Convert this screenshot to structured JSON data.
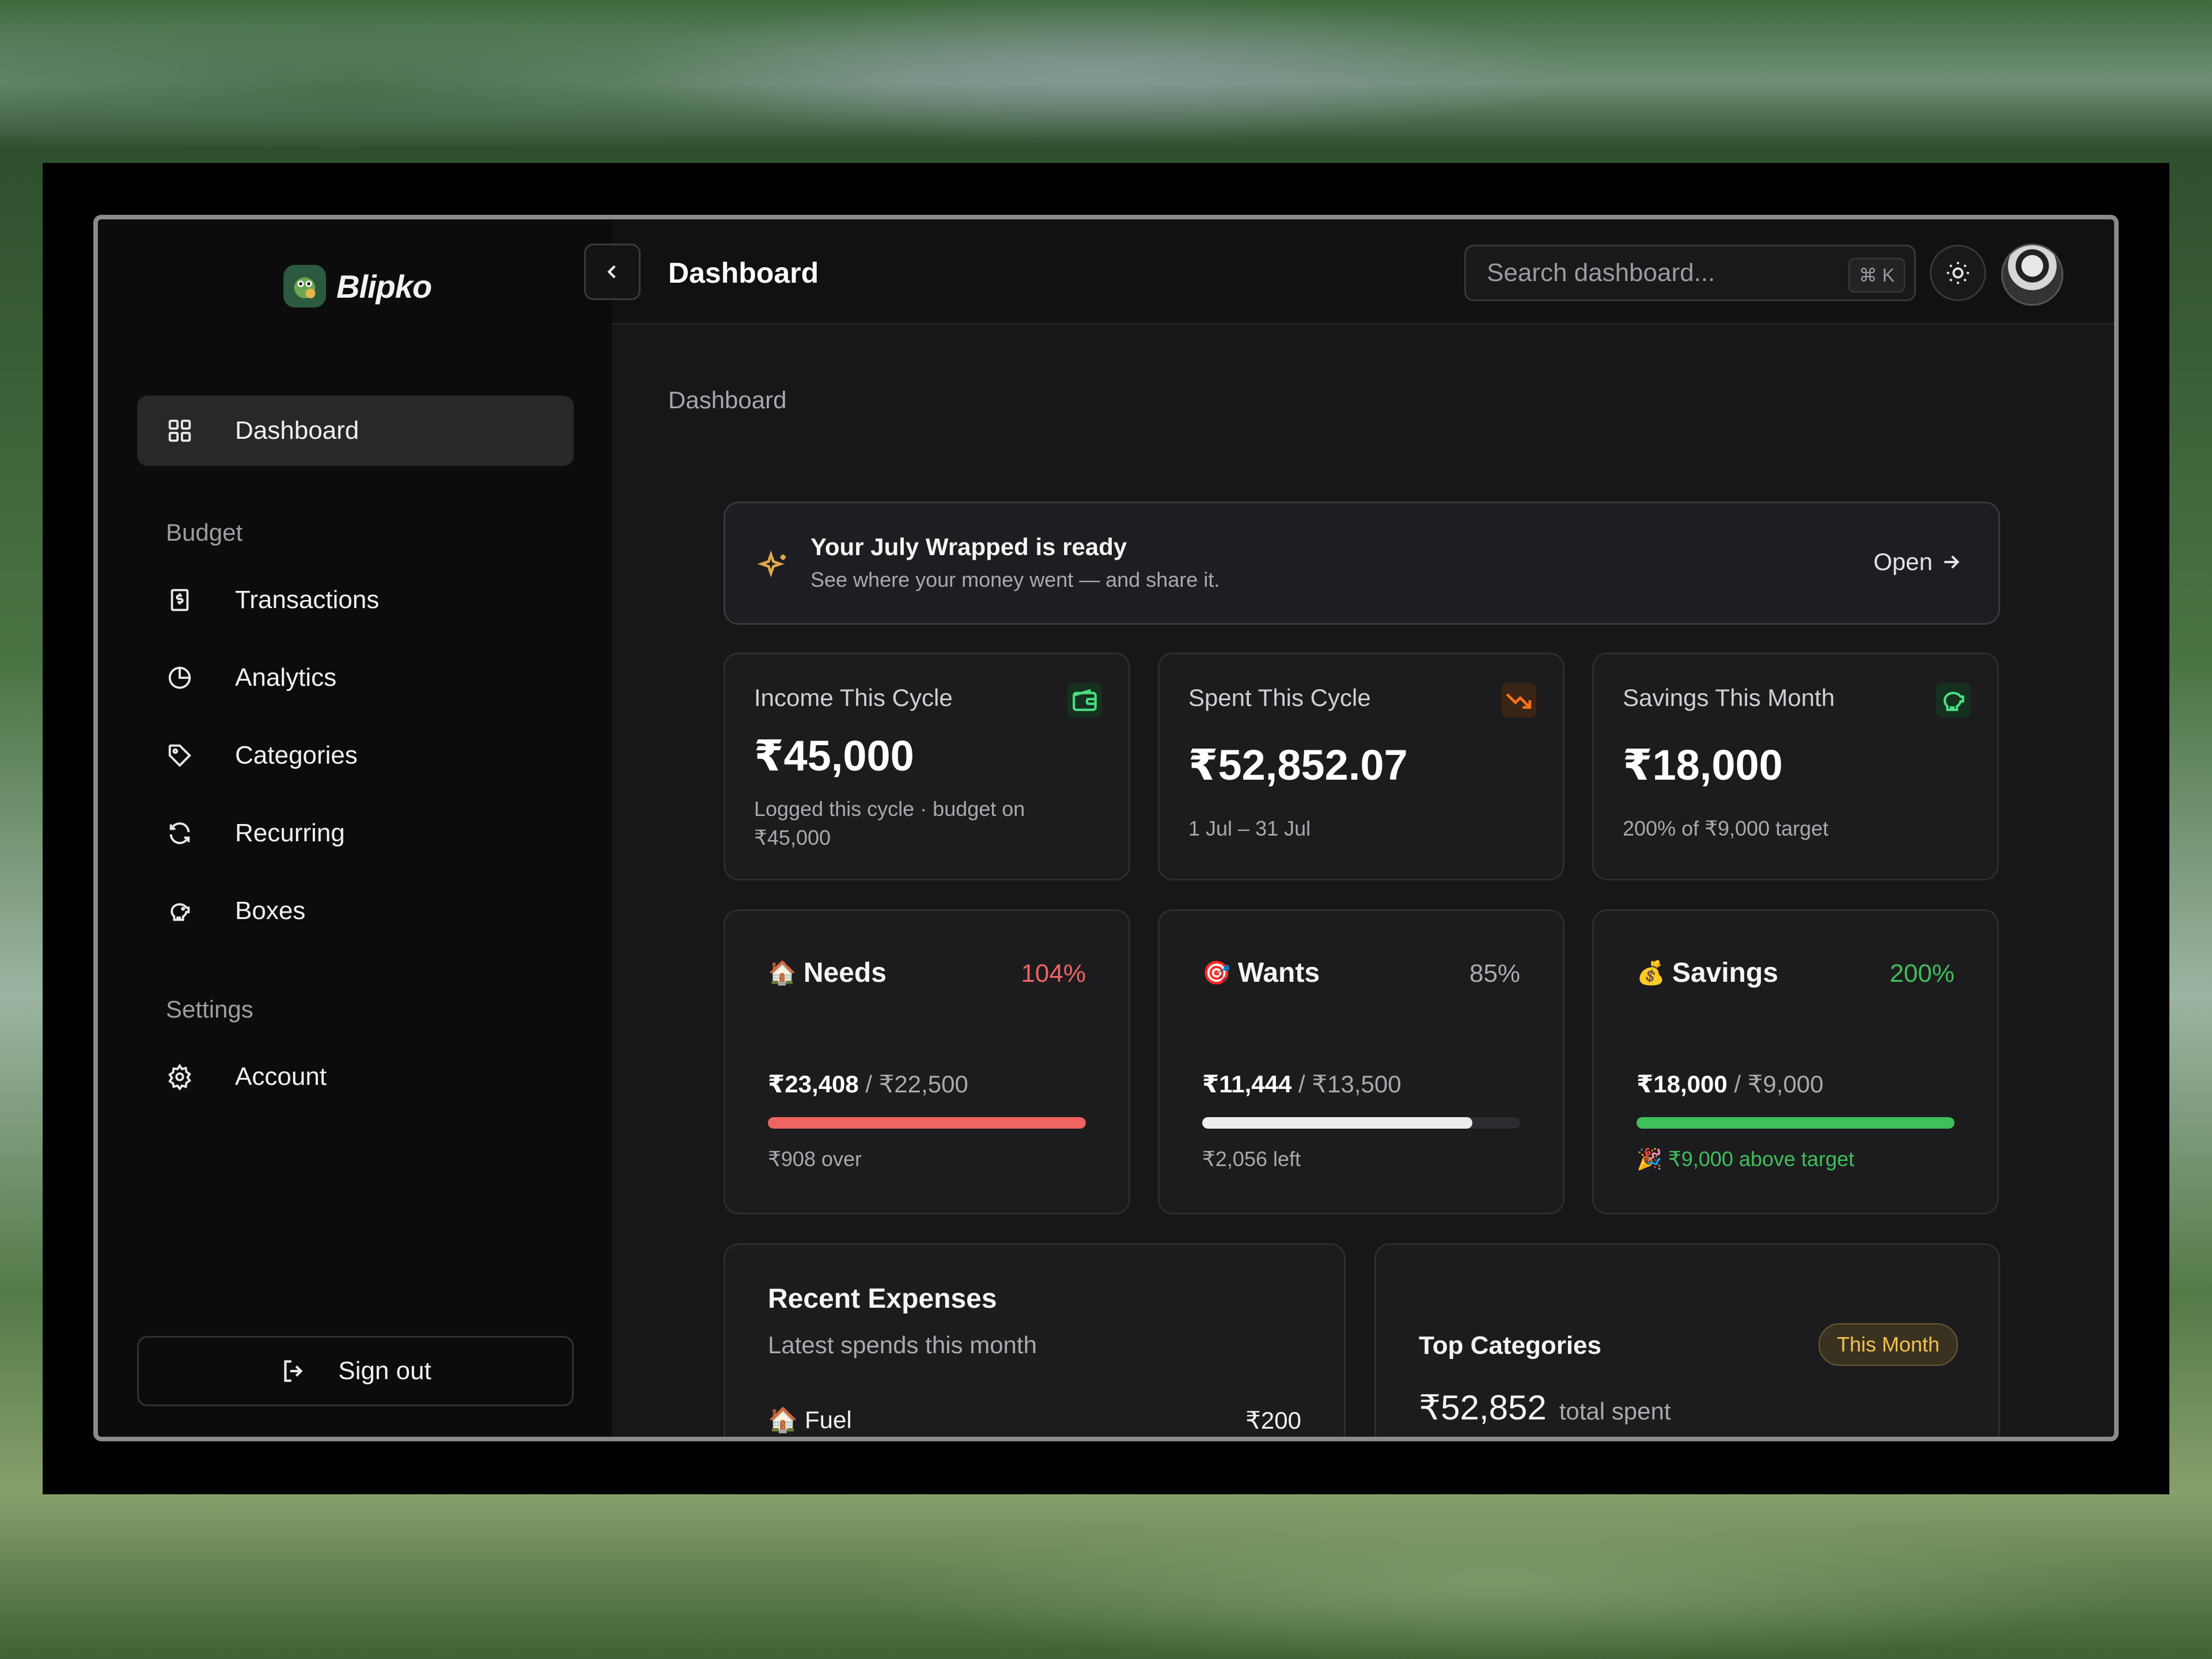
{
  "app": {
    "name": "Blipko"
  },
  "sidebar": {
    "dashboard": "Dashboard",
    "budget_label": "Budget",
    "items": [
      {
        "label": "Transactions",
        "icon": "receipt-icon"
      },
      {
        "label": "Analytics",
        "icon": "pie-chart-icon"
      },
      {
        "label": "Categories",
        "icon": "tag-icon"
      },
      {
        "label": "Recurring",
        "icon": "refresh-icon"
      },
      {
        "label": "Boxes",
        "icon": "piggy-bank-icon"
      }
    ],
    "settings_label": "Settings",
    "account": "Account",
    "signout": "Sign out"
  },
  "header": {
    "title": "Dashboard",
    "search_placeholder": "Search dashboard...",
    "shortcut": "⌘ K"
  },
  "breadcrumb": "Dashboard",
  "banner": {
    "title": "Your July Wrapped is ready",
    "subtitle": "See where your money went — and share it.",
    "action": "Open"
  },
  "stats": {
    "income": {
      "title": "Income This Cycle",
      "value": "₹45,000",
      "note": "Logged this cycle · budget on ₹45,000",
      "color": "#4ade80"
    },
    "spent": {
      "title": "Spent This Cycle",
      "value": "₹52,852.07",
      "note": "1 Jul – 31 Jul",
      "color": "#f97316"
    },
    "savings": {
      "title": "Savings This Month",
      "value": "₹18,000",
      "note": "200% of ₹9,000 target",
      "color": "#4ade80"
    }
  },
  "budgets": {
    "needs": {
      "emoji": "🏠",
      "label": "Needs",
      "pct": "104%",
      "spent": "₹23,408",
      "limit": "₹22,500",
      "note": "₹908 over",
      "fill": 1.0,
      "color": "#ef6461"
    },
    "wants": {
      "emoji": "🎯",
      "label": "Wants",
      "pct": "85%",
      "spent": "₹11,444",
      "limit": "₹13,500",
      "note": "₹2,056 left",
      "fill": 0.85,
      "color": "#ededed"
    },
    "savings": {
      "emoji": "💰",
      "label": "Savings",
      "pct": "200%",
      "spent": "₹18,000",
      "limit": "₹9,000",
      "note": "₹9,000 above target",
      "note_emoji": "🎉",
      "fill": 1.0,
      "color": "#3fbf5a"
    }
  },
  "recent": {
    "title": "Recent Expenses",
    "subtitle": "Latest spends this month",
    "rows": [
      {
        "emoji": "🏠",
        "name": "Fuel",
        "amount": "₹200"
      }
    ]
  },
  "top_categories": {
    "title": "Top Categories",
    "badge": "This Month",
    "total": "₹52,852",
    "total_label": "total spent"
  }
}
